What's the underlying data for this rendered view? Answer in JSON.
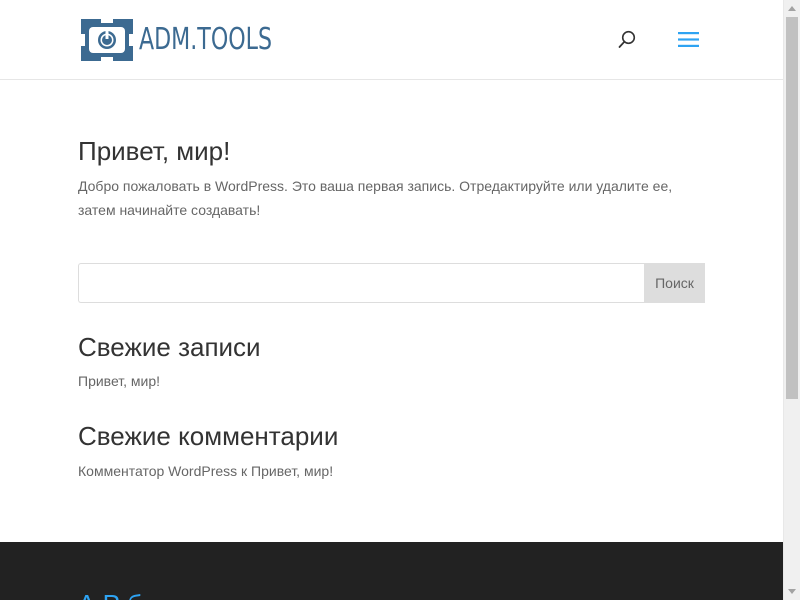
{
  "header": {
    "logo_text": "ADM.TOOLS",
    "brand_color": "#3c6a91",
    "search_icon": "search-icon",
    "menu_icon": "hamburger-menu-icon",
    "menu_icon_color": "#2ea3f2"
  },
  "post": {
    "title": "Привет, мир!",
    "excerpt": "Добро пожаловать в WordPress. Это ваша первая запись. Отредактируйте или удалите ее, затем начинайте создавать!"
  },
  "search": {
    "value": "",
    "placeholder": "",
    "button_label": "Поиск"
  },
  "widgets": {
    "recent_posts": {
      "title": "Свежие записи",
      "items": [
        "Привет, мир!"
      ]
    },
    "recent_comments": {
      "title": "Свежие комментарии",
      "author": "Комментатор WordPress",
      "connector": " к ",
      "post": "Привет, мир!"
    }
  },
  "footer": {
    "title_partial": "А     Р б",
    "background": "#222222",
    "accent": "#2ea3f2"
  }
}
